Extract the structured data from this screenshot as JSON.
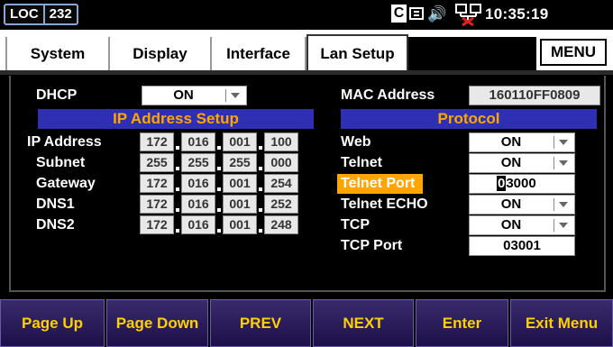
{
  "status_bar": {
    "mode": "LOC",
    "address": "232",
    "c_indicator": "C",
    "keyboard_icon": "keyboard-icon",
    "speaker_icon": "speaker-icon",
    "network_icon": "network-disconnected-icon",
    "time": "10:35:19",
    "colors": {
      "frame": "#8aa6d6",
      "network_error": "#e02020"
    }
  },
  "tabs": [
    {
      "label": "System",
      "active": false
    },
    {
      "label": "Display",
      "active": false
    },
    {
      "label": "Interface",
      "active": false
    },
    {
      "label": "Lan Setup",
      "active": true
    }
  ],
  "menu_label": "MENU",
  "dhcp": {
    "label": "DHCP",
    "value": "ON"
  },
  "ip_setup": {
    "title": "IP Address Setup",
    "rows": [
      {
        "label": "IP Address",
        "octets": [
          "172",
          "016",
          "001",
          "100"
        ]
      },
      {
        "label": "Subnet",
        "octets": [
          "255",
          "255",
          "255",
          "000"
        ]
      },
      {
        "label": "Gateway",
        "octets": [
          "172",
          "016",
          "001",
          "254"
        ]
      },
      {
        "label": "DNS1",
        "octets": [
          "172",
          "016",
          "001",
          "252"
        ]
      },
      {
        "label": "DNS2",
        "octets": [
          "172",
          "016",
          "001",
          "248"
        ]
      }
    ]
  },
  "mac": {
    "label": "MAC Address",
    "value": "160110FF0809"
  },
  "protocol": {
    "title": "Protocol",
    "web": {
      "label": "Web",
      "value": "ON"
    },
    "telnet": {
      "label": "Telnet",
      "value": "ON"
    },
    "telnet_port": {
      "label": "Telnet Port",
      "value_first": "0",
      "value_rest": "3000"
    },
    "telnet_echo": {
      "label": "Telnet ECHO",
      "value": "ON"
    },
    "tcp": {
      "label": "TCP",
      "value": "ON"
    },
    "tcp_port": {
      "label": "TCP Port",
      "value": "03001"
    }
  },
  "softkeys": [
    "Page Up",
    "Page Down",
    "PREV",
    "NEXT",
    "Enter",
    "Exit Menu"
  ],
  "colors": {
    "header_bg": "#2f2fb4",
    "header_text": "#ffa500",
    "softkey_text": "#ffd000",
    "selection": "#ffa500"
  }
}
